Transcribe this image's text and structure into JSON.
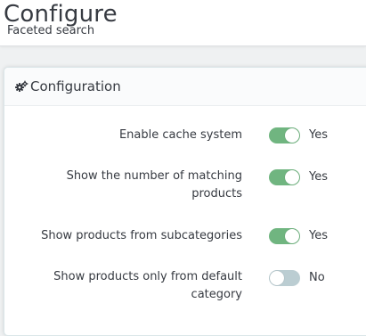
{
  "header": {
    "title": "Configure",
    "subtitle": "Faceted search"
  },
  "panel": {
    "icon": "cogs-icon",
    "title": "Configuration",
    "accent_on": "#70b580",
    "accent_off": "#bbcdd2",
    "settings": [
      {
        "label": "Enable cache system",
        "value": "Yes",
        "enabled": true
      },
      {
        "label": "Show the number of matching products",
        "value": "Yes",
        "enabled": true
      },
      {
        "label": "Show products from subcategories",
        "value": "Yes",
        "enabled": true
      },
      {
        "label": "Show products only from default category",
        "value": "No",
        "enabled": false
      }
    ]
  }
}
